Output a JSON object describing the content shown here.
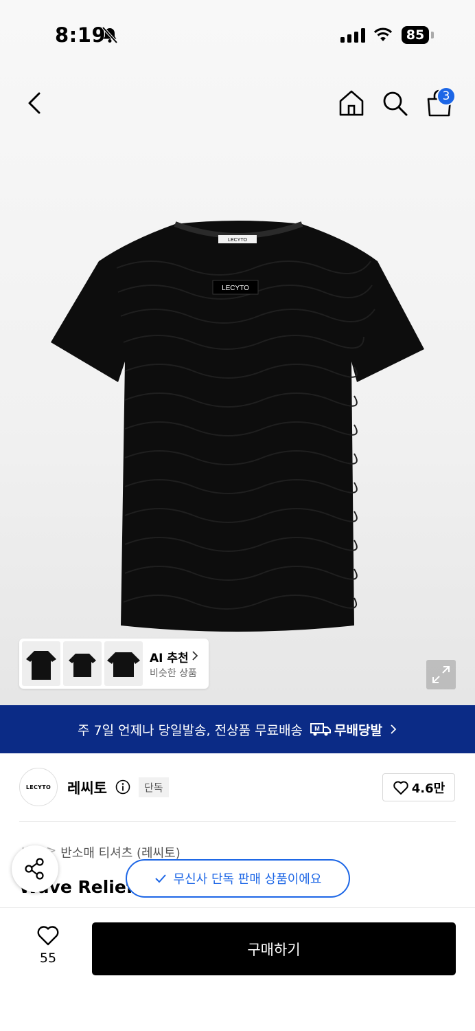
{
  "status_bar": {
    "time": "8:19",
    "battery": "85"
  },
  "nav": {
    "cart_count": "3"
  },
  "product_image": {
    "logo_text": "LECYTO",
    "neck_label_text": "LECYTO"
  },
  "ai_recommend": {
    "title": "AI 추천",
    "subtitle": "비슷한 상품"
  },
  "banner": {
    "text": "주 7일 언제나 당일발송, 전상품 무료배송",
    "logo_label": "무배당발"
  },
  "brand": {
    "logo_text": "LECYTO",
    "name": "레씨토",
    "tag": "단독",
    "likes": "4.6만"
  },
  "breadcrumb": {
    "parent": "상의",
    "separator": ">",
    "category": "반소매 티셔츠 (레씨토)"
  },
  "product": {
    "title": "Wave Relief"
  },
  "toast": {
    "text": "무신사 단독 판매 상품이에요"
  },
  "bottom_bar": {
    "wish_count": "55",
    "buy_label": "구매하기"
  },
  "colors": {
    "accent_blue": "#1c66e6",
    "banner_navy": "#0b2b86",
    "buy_button": "#000000"
  },
  "icons": [
    "bell-slash-icon",
    "signal-icon",
    "wifi-icon",
    "battery-icon",
    "back-arrow-icon",
    "home-icon",
    "search-icon",
    "cart-icon",
    "chevron-right-icon",
    "expand-icon",
    "truck-icon",
    "info-icon",
    "heart-icon",
    "share-icon",
    "check-icon"
  ]
}
